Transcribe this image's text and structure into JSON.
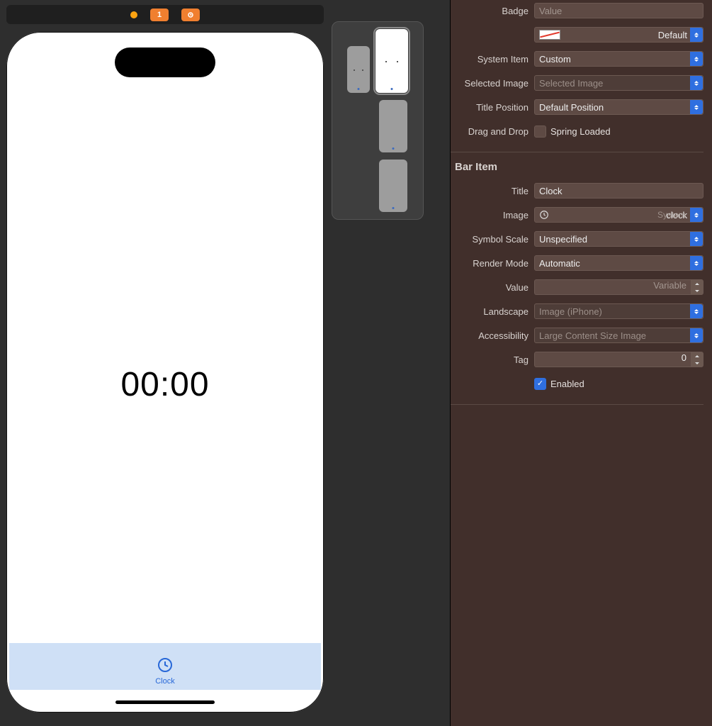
{
  "toolbar": {
    "warning_count": "1"
  },
  "device": {
    "timer_text": "00:00",
    "tab_label": "Clock"
  },
  "inspector": {
    "tab_bar_item": {
      "badge_label": "Badge",
      "badge_placeholder": "Value",
      "badge_color_label": "Default",
      "system_item_label": "System Item",
      "system_item_value": "Custom",
      "selected_image_label": "Selected Image",
      "selected_image_placeholder": "Selected Image",
      "title_position_label": "Title Position",
      "title_position_value": "Default Position",
      "drag_drop_label": "Drag and Drop",
      "spring_loaded_label": "Spring Loaded",
      "spring_loaded_checked": false
    },
    "bar_item": {
      "section_title": "Bar Item",
      "title_label": "Title",
      "title_value": "Clock",
      "image_label": "Image",
      "image_value": "clock",
      "image_system_tag": "System",
      "symbol_scale_label": "Symbol Scale",
      "symbol_scale_value": "Unspecified",
      "render_mode_label": "Render Mode",
      "render_mode_value": "Automatic",
      "value_label": "Value",
      "value_placeholder": "Variable",
      "landscape_label": "Landscape",
      "landscape_placeholder": "Image (iPhone)",
      "accessibility_label": "Accessibility",
      "accessibility_placeholder": "Large Content Size Image",
      "tag_label": "Tag",
      "tag_value": "0",
      "enabled_label": "Enabled",
      "enabled_checked": true
    }
  }
}
